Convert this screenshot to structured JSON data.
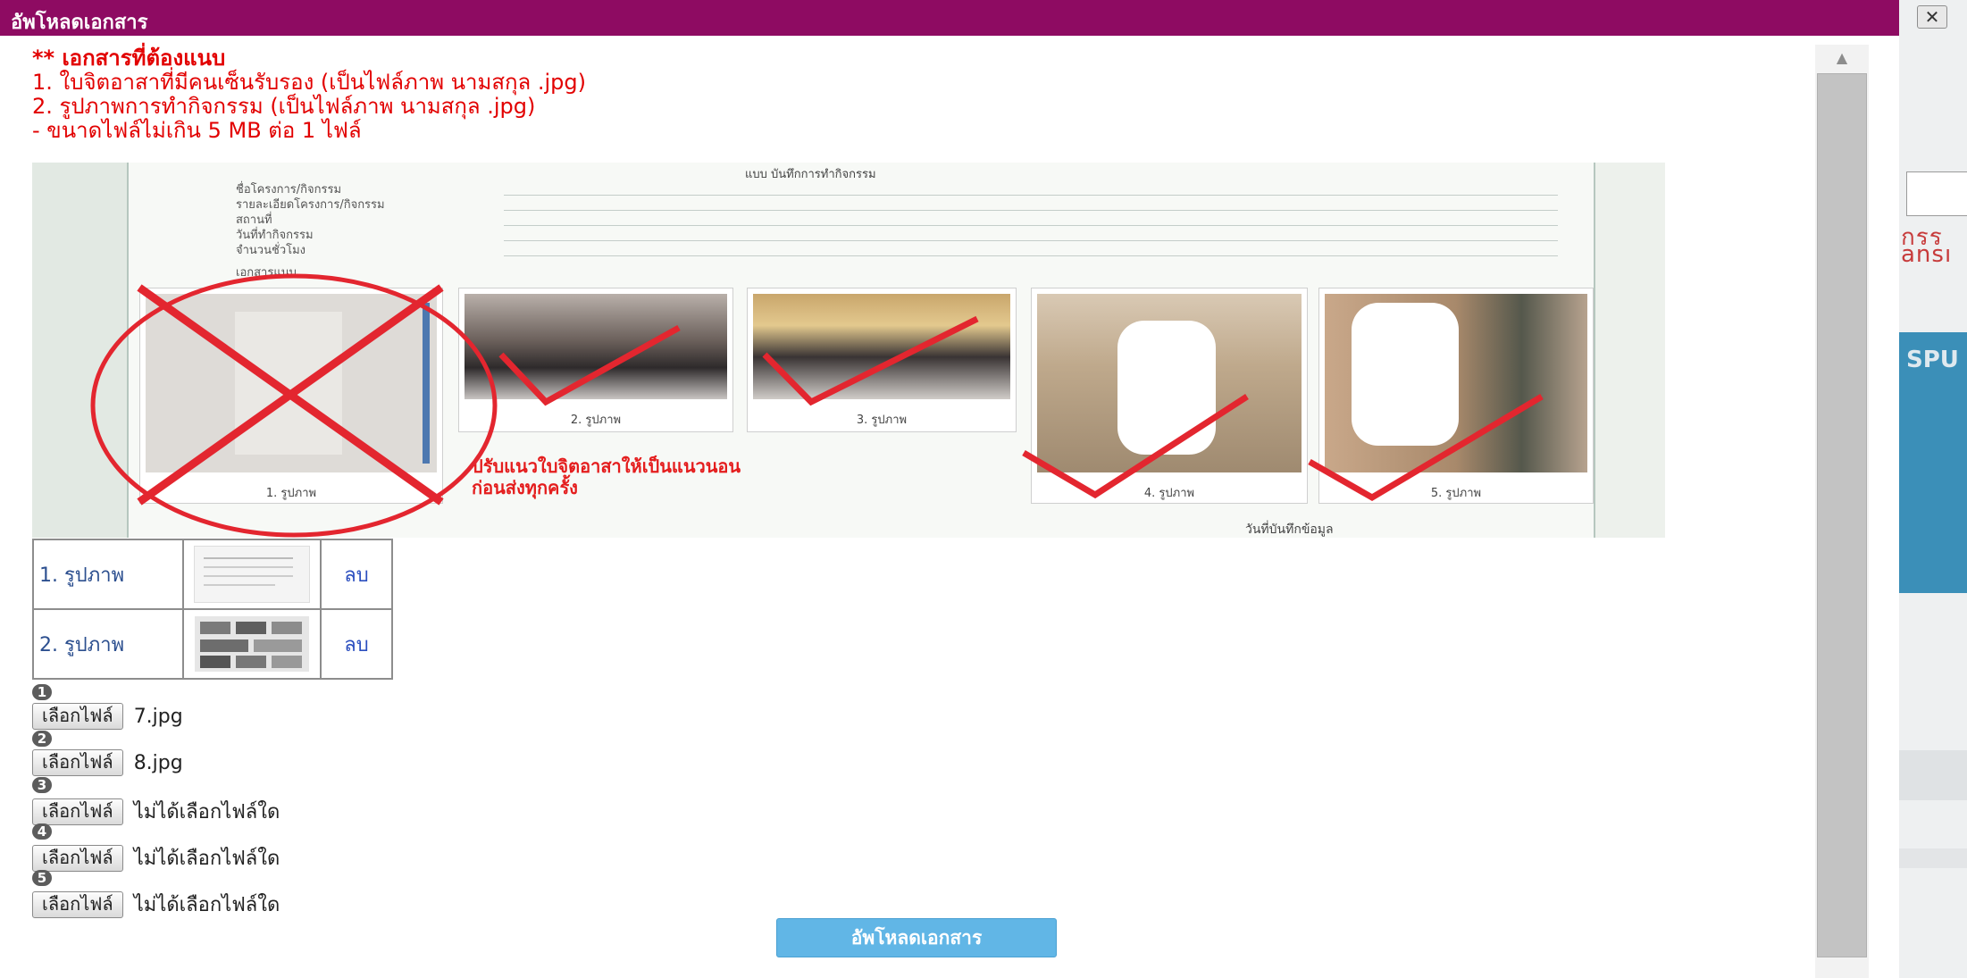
{
  "dialog": {
    "title": "อัพโหลดเอกสาร",
    "close_icon": "close-icon",
    "requirements": {
      "heading": "** เอกสารที่ต้องแนบ",
      "items": [
        "1. ใบจิตอาสาที่มีคนเซ็นรับรอง (เป็นไฟล์ภาพ นามสกุล .jpg)",
        "2. รูปภาพการทำกิจกรรม (เป็นไฟล์ภาพ นามสกุล .jpg)",
        "- ขนาดไฟล์ไม่เกิน 5 MB ต่อ 1 ไฟล์"
      ]
    },
    "example": {
      "header": "แบบ บันทึกการทำกิจกรรม",
      "form_labels": [
        "ชื่อโครงการ/กิจกรรม",
        "รายละเอียดโครงการ/กิจกรรม",
        "สถานที่",
        "วันที่ทำกิจกรรม",
        "จำนวนชั่วโมง"
      ],
      "sub_label": "เอกสารแนบ",
      "captions": [
        "1. รูปภาพ",
        "2. รูปภาพ",
        "3. รูปภาพ",
        "4. รูปภาพ",
        "5. รูปภาพ"
      ],
      "note_lines": [
        "ปรับแนวใบจิตอาสาให้เป็นแนวนอน",
        "ก่อนส่งทุกครั้ง"
      ],
      "footer": "วันที่บันทึกข้อมูล",
      "colors": {
        "cross": "#e3262f",
        "check": "#e3262f"
      }
    },
    "uploaded": [
      {
        "label": "1. รูปภาพ",
        "delete_label": "ลบ"
      },
      {
        "label": "2. รูปภาพ",
        "delete_label": "ลบ"
      }
    ],
    "inputs": [
      {
        "number": "1",
        "button": "เลือกไฟล์",
        "filename": "7.jpg"
      },
      {
        "number": "2",
        "button": "เลือกไฟล์",
        "filename": "8.jpg"
      },
      {
        "number": "3",
        "button": "เลือกไฟล์",
        "filename": "ไม่ได้เลือกไฟล์ใด"
      },
      {
        "number": "4",
        "button": "เลือกไฟล์",
        "filename": "ไม่ได้เลือกไฟล์ใด"
      },
      {
        "number": "5",
        "button": "เลือกไฟล์",
        "filename": "ไม่ได้เลือกไฟล์ใด"
      }
    ],
    "submit_label": "อัพโหลดเอกสาร"
  },
  "background": {
    "fragment_1": "กรร",
    "fragment_2": "ansı",
    "fragment_3": "SPU"
  },
  "theme": {
    "titlebar": "#8e0b62",
    "requirement_text": "#e20000",
    "submit_button": "#61b6e6",
    "link": "#2c4fbf"
  }
}
